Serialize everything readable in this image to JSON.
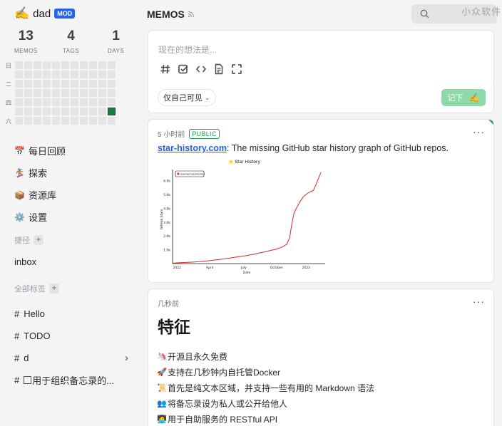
{
  "sidebar": {
    "user": {
      "emoji": "✍️",
      "name": "dad",
      "role": "MOD"
    },
    "stats": [
      {
        "value": "13",
        "label": "MEMOS"
      },
      {
        "value": "4",
        "label": "TAGS"
      },
      {
        "value": "1",
        "label": "DAYS"
      }
    ],
    "heatmap": {
      "weekdays": [
        "日",
        "二",
        "四",
        "六"
      ],
      "columns": 11,
      "rows": 7,
      "active_cells": [
        [
          10,
          5
        ]
      ],
      "active_color": "#15803d"
    },
    "nav": [
      {
        "icon": "calendar-icon",
        "glyph": "📅",
        "label": "每日回顾"
      },
      {
        "icon": "explore-icon",
        "glyph": "🏂",
        "label": "探索"
      },
      {
        "icon": "box-icon",
        "glyph": "📦",
        "label": "资源库"
      },
      {
        "icon": "gear-icon",
        "glyph": "⚙️",
        "label": "设置"
      }
    ],
    "shortcuts_label": "捷径",
    "shortcuts": [
      "inbox"
    ],
    "tags_label": "全部标签",
    "tags": [
      {
        "name": "Hello",
        "has_children": false
      },
      {
        "name": "TODO",
        "has_children": false
      },
      {
        "name": "d",
        "has_children": true
      },
      {
        "name": "用于组织备忘录的...",
        "has_box": true,
        "has_children": false
      }
    ]
  },
  "header": {
    "title": "MEMOS",
    "watermark": "小众软件"
  },
  "editor": {
    "placeholder": "现在的想法是...",
    "tools": [
      "hash-icon",
      "checkbox-icon",
      "code-icon",
      "file-icon",
      "fullscreen-icon"
    ],
    "visibility": "仅自己可见",
    "save_label": "记下",
    "save_emoji": "✍️"
  },
  "memos": [
    {
      "time": "5 小时前",
      "visibility": "PUBLIC",
      "link_text": "star-history.com",
      "text": ": The missing GitHub star history graph of GitHub repos."
    },
    {
      "time": "几秒前",
      "heading": "特征",
      "features": [
        {
          "glyph": "🦄",
          "text": "开源且永久免费"
        },
        {
          "glyph": "🚀",
          "text": "支持在几秒钟内自托管Docker"
        },
        {
          "glyph": "📜",
          "text": "首先是纯文本区域，并支持一些有用的 Markdown 语法"
        },
        {
          "glyph": "👥",
          "text": "将备忘录设为私人或公开给他人"
        },
        {
          "glyph": "🧑‍💻",
          "text": "用于自助服务的 RESTful API"
        }
      ]
    }
  ],
  "chart_data": {
    "type": "line",
    "title": "Star History",
    "title_emoji": "⭐",
    "xlabel": "Date",
    "ylabel": "GitHub Stars",
    "x_ticks": [
      "2022",
      "April",
      "July",
      "October",
      "2023"
    ],
    "y_ticks": [
      "1.0k",
      "2.0k",
      "3.0k",
      "4.0k",
      "5.0k",
      "6.0k"
    ],
    "ylim": [
      0,
      6800
    ],
    "legend": "usememos/memos",
    "series": [
      {
        "name": "usememos/memos",
        "color": "#dc2626",
        "x": [
          0,
          0.05,
          0.1,
          0.15,
          0.2,
          0.25,
          0.3,
          0.35,
          0.4,
          0.45,
          0.5,
          0.55,
          0.6,
          0.65,
          0.7,
          0.74,
          0.77,
          0.79,
          0.8,
          0.81,
          0.82,
          0.84,
          0.86,
          0.88,
          0.9,
          0.92,
          0.95,
          0.97,
          1.0
        ],
        "y": [
          30,
          60,
          90,
          120,
          160,
          210,
          280,
          340,
          420,
          500,
          580,
          680,
          800,
          920,
          1050,
          1200,
          1400,
          1900,
          2600,
          3200,
          3700,
          4100,
          4500,
          4800,
          5000,
          5150,
          5300,
          5800,
          6600
        ]
      }
    ]
  }
}
